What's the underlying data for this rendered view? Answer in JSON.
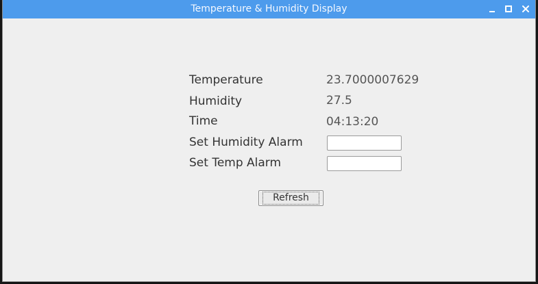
{
  "window": {
    "title": "Temperature & Humidity Display",
    "titlebar_color": "#4d9bec",
    "background_color": "#efefef",
    "controls": [
      "minimize-icon",
      "maximize-icon",
      "close-icon"
    ]
  },
  "readings": {
    "temperature_label": "Temperature",
    "temperature_value": "23.7000007629",
    "humidity_label": "Humidity",
    "humidity_value": "27.5",
    "time_label": "Time",
    "time_value": "04:13:20"
  },
  "alarms": {
    "humidity_label": "Set Humidity Alarm",
    "humidity_value": "",
    "temp_label": "Set Temp Alarm",
    "temp_value": ""
  },
  "actions": {
    "refresh_label": "Refresh"
  }
}
